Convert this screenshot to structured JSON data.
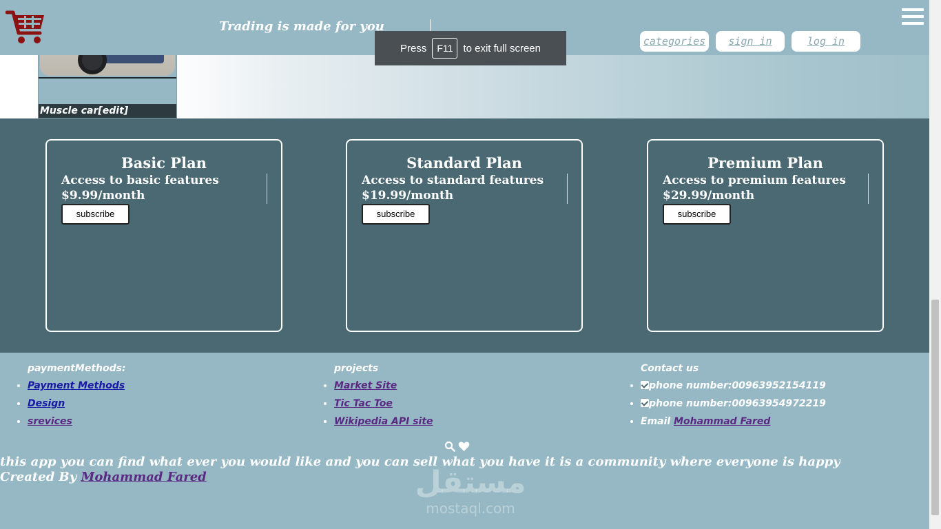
{
  "header": {
    "tagline": "Trading is made for you",
    "nav": {
      "categories": "categories",
      "sign_in": "sign in",
      "log_in": "log in"
    },
    "cart_icon": "shopping-cart-icon",
    "menu_icon": "hamburger-menu-icon",
    "accent_color": "#8b1212"
  },
  "fullscreen_toast": {
    "press": "Press",
    "key": "F11",
    "rest": "to exit full screen"
  },
  "product_card": {
    "caption": "Muscle car[edit]"
  },
  "plans": [
    {
      "title": "Basic Plan",
      "desc": "Access to basic features",
      "price": "$9.99/month",
      "button": "subscribe"
    },
    {
      "title": "Standard Plan",
      "desc": "Access to standard features",
      "price": "$19.99/month",
      "button": "subscribe"
    },
    {
      "title": "Premium Plan",
      "desc": "Access to premium features",
      "price": "$29.99/month",
      "button": "subscribe"
    }
  ],
  "footer": {
    "payment": {
      "heading": "paymentMethods:",
      "links": [
        "Payment Methods",
        "Design",
        "srevices"
      ]
    },
    "projects": {
      "heading": "projects",
      "links": [
        "Market Site",
        "Tic Tac Toe",
        "Wikipedia API site"
      ]
    },
    "contact": {
      "heading": "Contact us",
      "phone1": "phone number:00963952154119",
      "phone2": "phone number:00963954972219",
      "email_label": "Email",
      "email_link": "Mohammad Fared"
    },
    "about_text": "this app you can find what ever you would like and you can sell what you have it is a community where everyone is happy",
    "created_by_label": "Created By",
    "created_by_link": "Mohammad Fared",
    "watermark_ar": "مستقل",
    "watermark_lat": "mostaql.com"
  }
}
